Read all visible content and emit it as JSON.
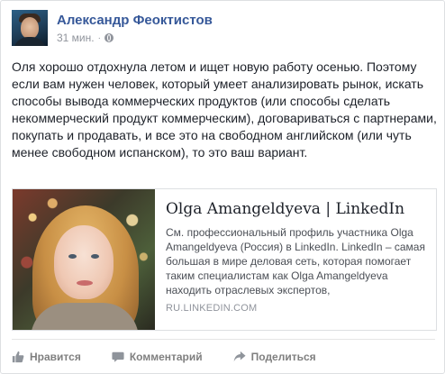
{
  "post": {
    "author": "Александр Феоктистов",
    "time": "31 мин.",
    "separator": "·",
    "text": "Оля хорошо отдохнула летом и ищет новую работу осенью. Поэтому если вам нужен человек, который умеет анализировать рынок, искать способы вывода коммерческих продуктов (или способы сделать некоммерческий продукт коммерческим), договариваться с партнерами, покупать и продавать, и все это на свободном английском (или чуть менее свободном испанском), то это ваш вариант."
  },
  "link": {
    "title": "Olga Amangeldyeva | LinkedIn",
    "description": "См. профессиональный профиль участника Olga Amangeldyeva (Россия) в LinkedIn. LinkedIn – самая большая в мире деловая сеть, которая помогает таким специалистам как Olga Amangeldyeva находить отраслевых экспертов,",
    "domain": "RU.LINKEDIN.COM"
  },
  "actions": {
    "like_label": "Нравится",
    "comment_label": "Комментарий",
    "share_label": "Поделиться"
  },
  "icons": {
    "privacy": "globe-icon",
    "like": "thumbs-up-icon",
    "comment": "speech-bubble-icon",
    "share": "share-arrow-icon"
  },
  "colors": {
    "author_link": "#365899",
    "secondary_text": "#90949c",
    "action_text": "#7f7f7f"
  }
}
